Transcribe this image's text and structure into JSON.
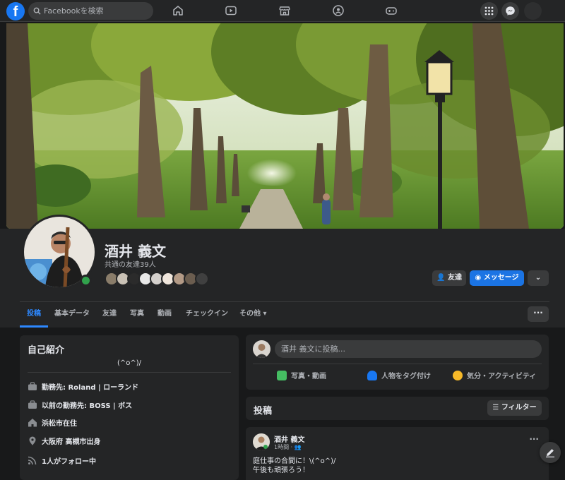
{
  "topbar": {
    "logo": "f",
    "search_placeholder": "Facebookを検索",
    "nav_icons": [
      "home-icon",
      "video-icon",
      "marketplace-icon",
      "groups-icon",
      "gaming-icon"
    ],
    "right_icons": [
      "menu-grid-icon",
      "messenger-icon"
    ]
  },
  "profile": {
    "name": "酒井 義文",
    "mutual_friends": "共通の友達39人",
    "mutual_avatar_colors": [
      "#8a7d6a",
      "#c9c1b5",
      "#2b2b2b",
      "#e8e8e8",
      "#d4d0cc",
      "#f0e6dc",
      "#b39a86",
      "#6b5d4f",
      "#404040"
    ],
    "friend_button": "友達",
    "message_button": "メッセージ",
    "more_chevron": "⌄"
  },
  "tabs": [
    {
      "label": "投稿",
      "active": true
    },
    {
      "label": "基本データ",
      "active": false
    },
    {
      "label": "友達",
      "active": false
    },
    {
      "label": "写真",
      "active": false
    },
    {
      "label": "動画",
      "active": false
    },
    {
      "label": "チェックイン",
      "active": false
    },
    {
      "label": "その他 ▾",
      "active": false
    }
  ],
  "tabs_more": "···",
  "intro": {
    "title": "自己紹介",
    "bio": "(^o^)/",
    "items": [
      {
        "icon": "briefcase-icon",
        "text": "勤務先: Roland | ローランド"
      },
      {
        "icon": "briefcase-icon",
        "text": "以前の勤務先: BOSS | ボス"
      },
      {
        "icon": "home-icon",
        "text": "浜松市在住"
      },
      {
        "icon": "location-pin-icon",
        "text": "大阪府 高槻市出身"
      },
      {
        "icon": "rss-icon",
        "text": "1人がフォロー中"
      }
    ]
  },
  "composer": {
    "placeholder": "酒井 義文に投稿...",
    "actions": [
      {
        "label": "写真・動画",
        "icon": "photo-icon",
        "color": "#45bd62"
      },
      {
        "label": "人物をタグ付け",
        "icon": "tag-people-icon",
        "color": "#1877f2"
      },
      {
        "label": "気分・アクティビティ",
        "icon": "feeling-icon",
        "color": "#f7b928"
      }
    ]
  },
  "posts_header": {
    "title": "投稿",
    "filter_label": "フィルター"
  },
  "post": {
    "author": "酒井 義文",
    "meta": "1時間 · 👥",
    "more": "···",
    "lines": [
      "庭仕事の合間に！\\(^o^)/",
      "午後も頑張ろう！"
    ]
  },
  "colors": {
    "accent": "#2d88ff",
    "surface": "#242526",
    "background": "#18191a",
    "online": "#31a24c"
  }
}
